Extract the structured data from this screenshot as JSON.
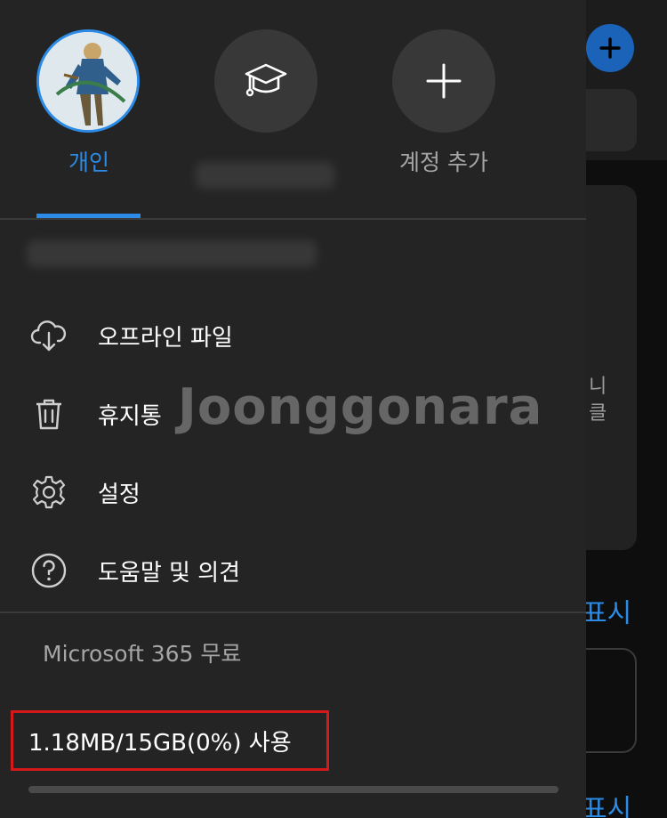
{
  "accounts": [
    {
      "label": "개인",
      "active": true,
      "icon": "user-avatar"
    },
    {
      "label": "",
      "active": false,
      "icon": "graduation-cap-icon"
    },
    {
      "label": "계정 추가",
      "active": false,
      "icon": "plus-icon"
    }
  ],
  "menu": [
    {
      "label": "오프라인 파일",
      "icon": "cloud-download-icon"
    },
    {
      "label": "휴지통",
      "icon": "trash-icon"
    },
    {
      "label": "설정",
      "icon": "gear-icon"
    },
    {
      "label": "도움말 및 의견",
      "icon": "help-circle-icon"
    }
  ],
  "watermark": "Joonggonara",
  "plan": "Microsoft 365 무료",
  "storage": {
    "text": "1.18MB/15GB(0%) 사용",
    "fraction": 0.0
  },
  "background": {
    "card_text": "니\n클",
    "link_1": "표시",
    "link_2": "표시"
  },
  "colors": {
    "accent": "#2b8be6",
    "highlight": "#d4191c",
    "drawer": "#242424"
  }
}
